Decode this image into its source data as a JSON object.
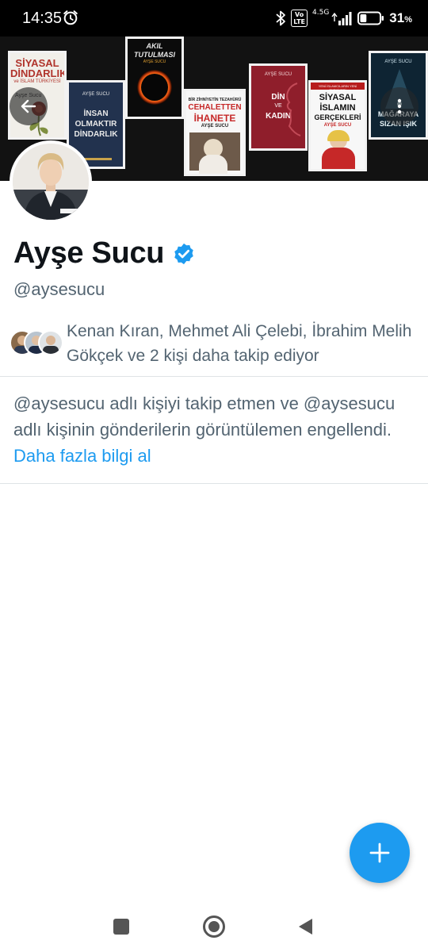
{
  "status_bar": {
    "time": "14:35",
    "network_type": "4.5G",
    "volte_top": "Vo",
    "volte_bottom": "LTE",
    "battery_percent": "31",
    "battery_unit": "%",
    "battery_level": 0.31
  },
  "banner": {
    "books": [
      {
        "author": "Ayşe Sucu",
        "title_1": "SİYASAL",
        "title_2": "DİNDARLIK",
        "subtitle": "ve İSLAM TÜRKİYESİ"
      },
      {
        "author": "AYŞE SUCU",
        "title_1": "İNSAN",
        "title_2": "OLMAKTIR",
        "title_3": "DİNDARLIK"
      },
      {
        "title_1": "AKIL",
        "title_2": "TUTULMASI",
        "author": "AYŞE SUCU"
      },
      {
        "tagline": "BİR ZİHNİYETİN TEZAHÜRÜ",
        "title_1": "CEHALETTEN",
        "title_2": "İHANETE",
        "author": "AYŞE SUCU"
      },
      {
        "author": "AYŞE SUCU",
        "title_1": "DİN",
        "title_2": "VE",
        "title_3": "KADIN"
      },
      {
        "tagline": "YENİ İSLAMCILARIN YENİ TÜRKİYESİ",
        "title_1": "SİYASAL",
        "title_2": "İSLAMIN",
        "title_3": "GERÇEKLERİ",
        "author": "AYŞE SUCU"
      },
      {
        "author": "AYŞE SUCU",
        "title_1": "MAĞARAYA",
        "title_2": "SIZAN IŞIK"
      }
    ]
  },
  "profile": {
    "display_name": "Ayşe Sucu",
    "handle": "@aysesucu",
    "followers_text": "Kenan Kıran, Mehmet Ali Çelebi, İbrahim Melih Gökçek ve 2 kişi daha takip ediyor",
    "blocked_text": "@aysesucu adlı kişiyi takip etmen ve @aysesucu adlı kişinin gönderilerin görüntülemen engellendi.",
    "learn_more_link": "Daha fazla bilgi al"
  },
  "icons": {
    "back": "arrow-left-icon",
    "more": "more-vertical-icon",
    "verified": "verified-badge-icon",
    "compose": "plus-icon"
  },
  "colors": {
    "accent": "#1d9bf0",
    "text_primary": "#0f1419",
    "text_secondary": "#536471",
    "divider": "#dfe3e6",
    "status_bar": "#000000"
  }
}
